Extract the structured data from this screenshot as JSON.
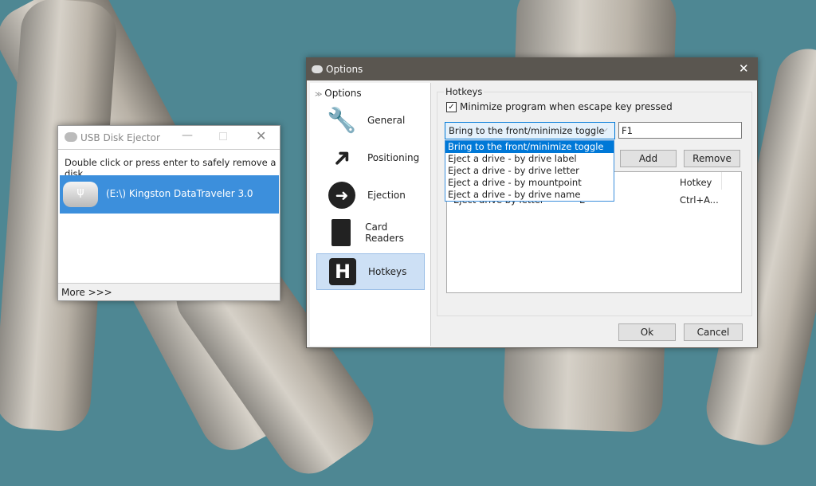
{
  "usb_window": {
    "title": "USB Disk Ejector",
    "instruction": "Double click or press enter to safely remove a disk",
    "drives": [
      {
        "label": "(E:\\) Kingston DataTraveler 3.0",
        "selected": true
      }
    ],
    "more_label": "More >>>"
  },
  "options_window": {
    "title": "Options",
    "tree_root": "Options",
    "nav": [
      {
        "label": "General",
        "icon": "wrench-icon"
      },
      {
        "label": "Positioning",
        "icon": "arrow-icon"
      },
      {
        "label": "Ejection",
        "icon": "eject-arrow-icon"
      },
      {
        "label": "Card Readers",
        "icon": "sd-card-icon"
      },
      {
        "label": "Hotkeys",
        "icon": "hotkey-h-icon",
        "selected": true
      }
    ],
    "group_title": "Hotkeys",
    "minimize_checkbox": {
      "label": "Minimize program when escape key pressed",
      "checked": true
    },
    "action_select": {
      "value": "Bring to the front/minimize toggle",
      "options": [
        "Bring to the front/minimize toggle",
        "Eject a drive - by drive label",
        "Eject a drive - by drive letter",
        "Eject a drive - by mountpoint",
        "Eject a drive - by drive name"
      ]
    },
    "hotkey_input": "F1",
    "add_label": "Add",
    "remove_label": "Remove",
    "table": {
      "headers": [
        "",
        "",
        "Hotkey"
      ],
      "rows": [
        [
          "Eject drive by letter",
          "E",
          "Ctrl+A..."
        ]
      ]
    },
    "ok_label": "Ok",
    "cancel_label": "Cancel"
  },
  "colors": {
    "selection": "#3c8fdc",
    "titlebar": "#5a5650"
  }
}
